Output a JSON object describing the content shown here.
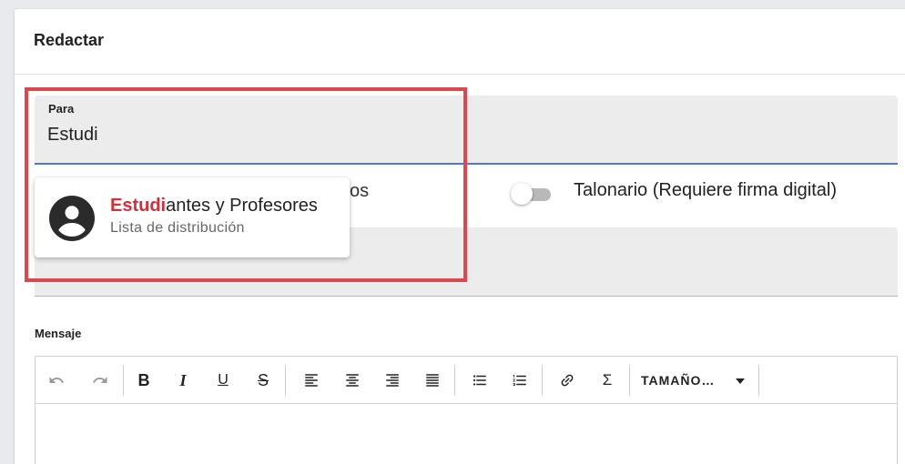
{
  "compose": {
    "title": "Redactar"
  },
  "to_field": {
    "label": "Para",
    "value": "Estudi"
  },
  "options": {
    "hidden_label_suffix": "os",
    "toggle_label": "Talonario (Requiere firma digital)",
    "toggle_on": false
  },
  "suggestion": {
    "match": "Estudi",
    "rest": "antes y Profesores",
    "subtitle": "Lista de distribución",
    "icon": "account-circle-icon"
  },
  "message": {
    "label": "Mensaje"
  },
  "toolbar": {
    "bold": "B",
    "italic": "I",
    "underline": "U",
    "strike": "S",
    "sigma": "Σ",
    "size_label": "TAMAÑO…"
  },
  "colors": {
    "accent": "#4a74e0",
    "highlight_text": "#d32f3a",
    "annotation_box": "#d9494f"
  }
}
